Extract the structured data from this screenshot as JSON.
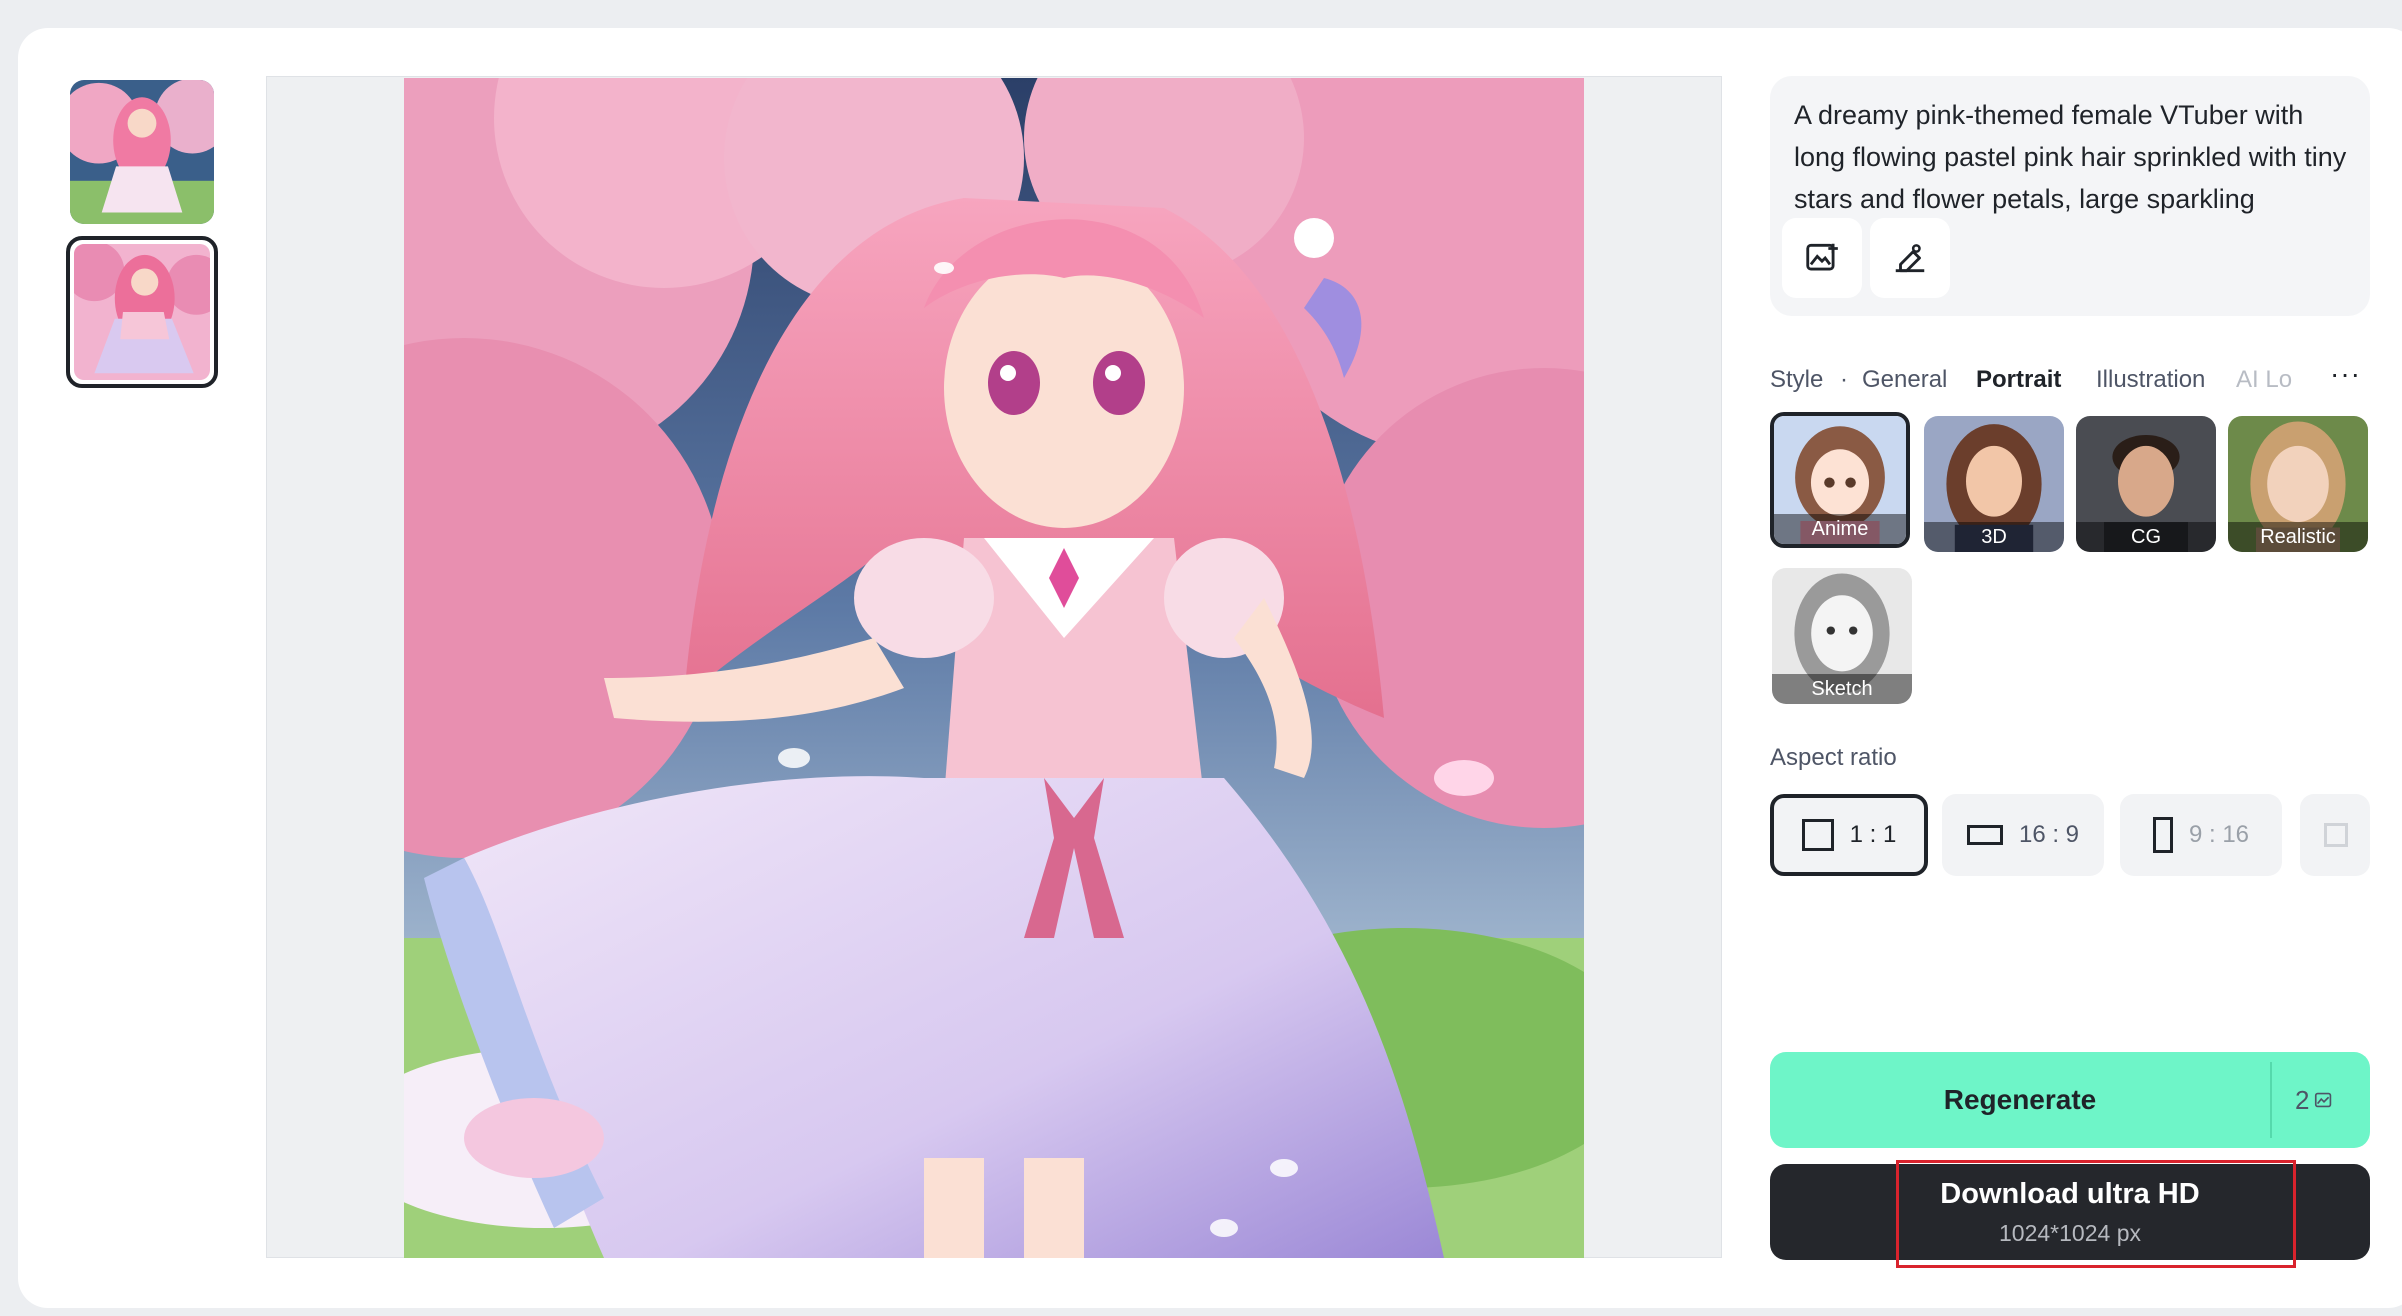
{
  "prompt": {
    "text": "A dreamy pink-themed female VTuber with long flowing pastel pink hair sprinkled with tiny stars and flower petals, large sparkling"
  },
  "prompt_tools": {
    "image_icon": "image-upload-icon",
    "edit_icon": "eraser-brush-icon"
  },
  "style": {
    "label": "Style",
    "dot": "·",
    "tabs": [
      "General",
      "Portrait",
      "Illustration",
      "AI Lo"
    ],
    "active_tab": "Portrait",
    "more": "···",
    "presets": [
      "Anime",
      "3D",
      "CG",
      "Realistic",
      "Sketch"
    ],
    "selected_preset": "Anime"
  },
  "aspect_ratio": {
    "label": "Aspect ratio",
    "options": [
      "1 : 1",
      "16 : 9",
      "9 : 16"
    ],
    "selected": "1 : 1"
  },
  "regenerate": {
    "label": "Regenerate",
    "credits": "2"
  },
  "download": {
    "label": "Download ultra HD",
    "resolution": "1024*1024 px"
  },
  "colors": {
    "accent": "#6ef5c8",
    "dark_button": "#25272c",
    "highlight": "#d9232d"
  }
}
